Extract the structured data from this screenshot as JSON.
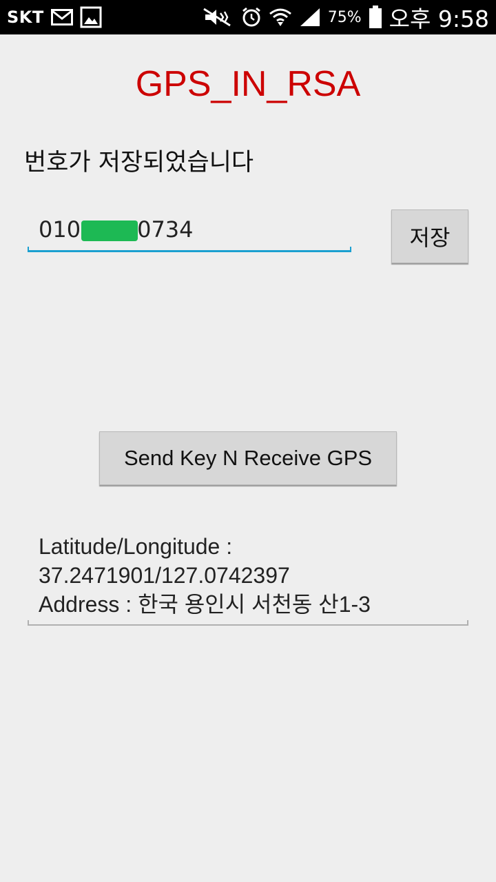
{
  "status_bar": {
    "carrier": "SKT",
    "left_icons": [
      "mail-icon",
      "gallery-icon"
    ],
    "right_icons": [
      "mute-icon",
      "alarm-icon",
      "wifi-icon",
      "signal-icon",
      "battery-icon"
    ],
    "battery_percent": "75%",
    "time": "오후 9:58"
  },
  "app": {
    "title": "GPS_IN_RSA",
    "title_color": "#cc0000",
    "status_message": "번호가 저장되었습니다",
    "phone_input": {
      "value_prefix": "010",
      "value_suffix": "0734",
      "underline_color": "#1a9fd0"
    },
    "save_button_label": "저장",
    "send_button_label": "Send Key N Receive GPS",
    "result": {
      "line1": "Latitude/Longitude :",
      "line2": "37.2471901/127.0742397",
      "line3": "Address : 한국 용인시 서천동 산1-3"
    }
  }
}
